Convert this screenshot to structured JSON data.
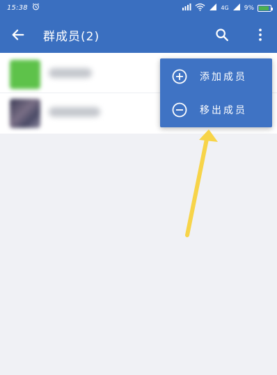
{
  "status_bar": {
    "time": "15:38",
    "signal_text": "4G",
    "battery_text": "9%",
    "battery_level": 0.9,
    "battery_color": "#4caf50"
  },
  "app_bar": {
    "title": "群成员(2)",
    "back_icon": "arrow-left-icon",
    "search_icon": "search-icon",
    "more_icon": "more-vertical-icon",
    "background": "#3a6fc0"
  },
  "members": [
    {
      "avatar_color": "#5ec24a"
    },
    {
      "avatar_color": "#4a4a66"
    }
  ],
  "menu": {
    "background": "#3f73c4",
    "items": [
      {
        "label": "添加成员",
        "icon": "plus-circle-icon"
      },
      {
        "label": "移出成员",
        "icon": "minus-circle-icon"
      }
    ]
  },
  "annotation": {
    "arrow_color": "#f7d449"
  }
}
